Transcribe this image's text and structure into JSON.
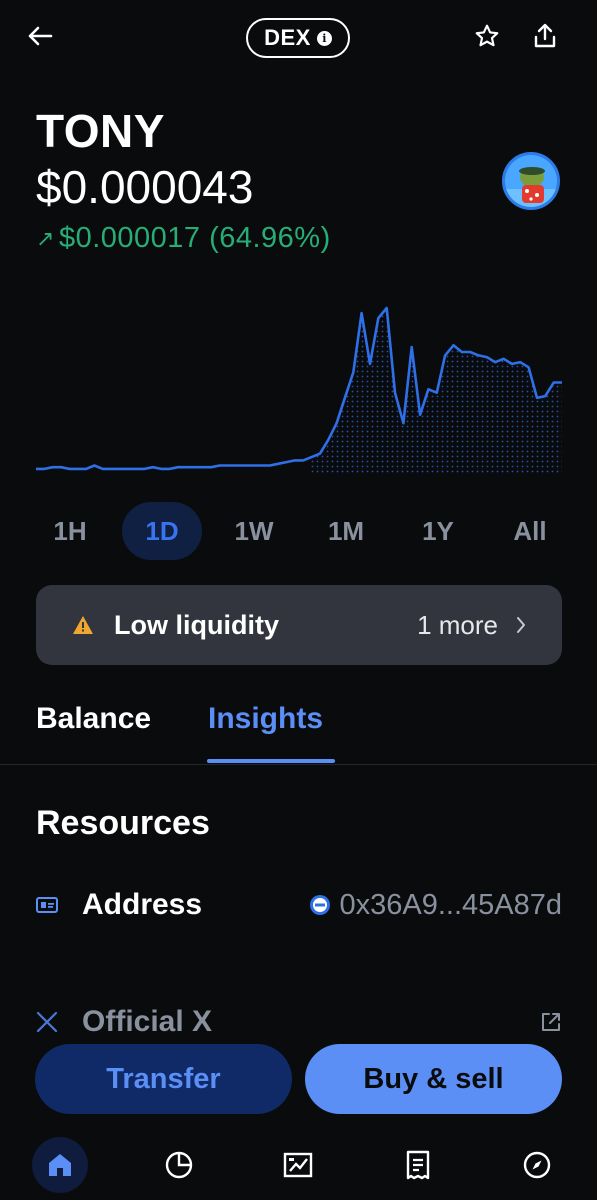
{
  "header": {
    "back_icon": "arrow-left-icon",
    "dex_label": "DEX",
    "dex_info_glyph": "i",
    "star_icon": "star-icon",
    "share_icon": "share-icon"
  },
  "token": {
    "name": "TONY",
    "price": "$0.000043",
    "change": "$0.000017 (64.96%)",
    "change_arrow": "↗",
    "change_color": "#27ad75",
    "avatar_icon": "token-avatar-icon"
  },
  "chart_data": {
    "type": "line",
    "x": [
      0,
      1,
      2,
      3,
      4,
      5,
      6,
      7,
      8,
      9,
      10,
      11,
      12,
      13,
      14,
      15,
      16,
      17,
      18,
      19,
      20,
      21,
      22,
      23,
      24,
      25,
      26,
      27,
      28,
      29,
      30,
      31,
      32,
      33,
      34,
      35,
      36,
      37,
      38,
      39,
      40,
      41,
      42,
      43,
      44,
      45,
      46,
      47,
      48,
      49,
      50,
      51,
      52,
      53,
      54,
      55,
      56,
      57,
      58,
      59,
      60,
      61,
      62,
      63
    ],
    "values": [
      0.3,
      0.3,
      0.4,
      0.4,
      0.3,
      0.3,
      0.3,
      0.5,
      0.3,
      0.3,
      0.3,
      0.3,
      0.3,
      0.3,
      0.4,
      0.3,
      0.3,
      0.4,
      0.4,
      0.4,
      0.4,
      0.4,
      0.5,
      0.5,
      0.5,
      0.5,
      0.5,
      0.5,
      0.5,
      0.6,
      0.7,
      0.8,
      0.8,
      1.0,
      1.2,
      2.0,
      3.0,
      4.5,
      6.0,
      9.5,
      6.5,
      9.2,
      9.8,
      4.8,
      3.0,
      7.5,
      3.5,
      5.0,
      4.8,
      7.0,
      7.6,
      7.2,
      7.2,
      7.0,
      6.9,
      6.6,
      6.8,
      6.5,
      6.6,
      6.3,
      4.5,
      4.6,
      5.4,
      5.4
    ],
    "line_color": "#2f6fe8",
    "grid": false
  },
  "range": {
    "options": [
      "1H",
      "1D",
      "1W",
      "1M",
      "1Y",
      "All"
    ],
    "selected_index": 1
  },
  "warning": {
    "icon": "warning-triangle-icon",
    "text": "Low liquidity",
    "more": "1 more",
    "chevron_icon": "chevron-right-icon"
  },
  "tabs": {
    "balance": "Balance",
    "insights": "Insights",
    "active": "insights"
  },
  "resources": {
    "title": "Resources",
    "address_icon": "id-card-icon",
    "address_label": "Address",
    "address_value": "0x36A9...45A87d",
    "address_chain_icon": "chain-badge-icon",
    "x_icon": "x-logo-icon",
    "x_label": "Official X",
    "x_external_icon": "external-link-icon"
  },
  "actions": {
    "transfer": "Transfer",
    "buy_sell": "Buy & sell"
  },
  "nav": {
    "items": [
      "home-icon",
      "portfolio-icon",
      "trade-icon",
      "transactions-icon",
      "explore-icon"
    ],
    "active_index": 0
  }
}
